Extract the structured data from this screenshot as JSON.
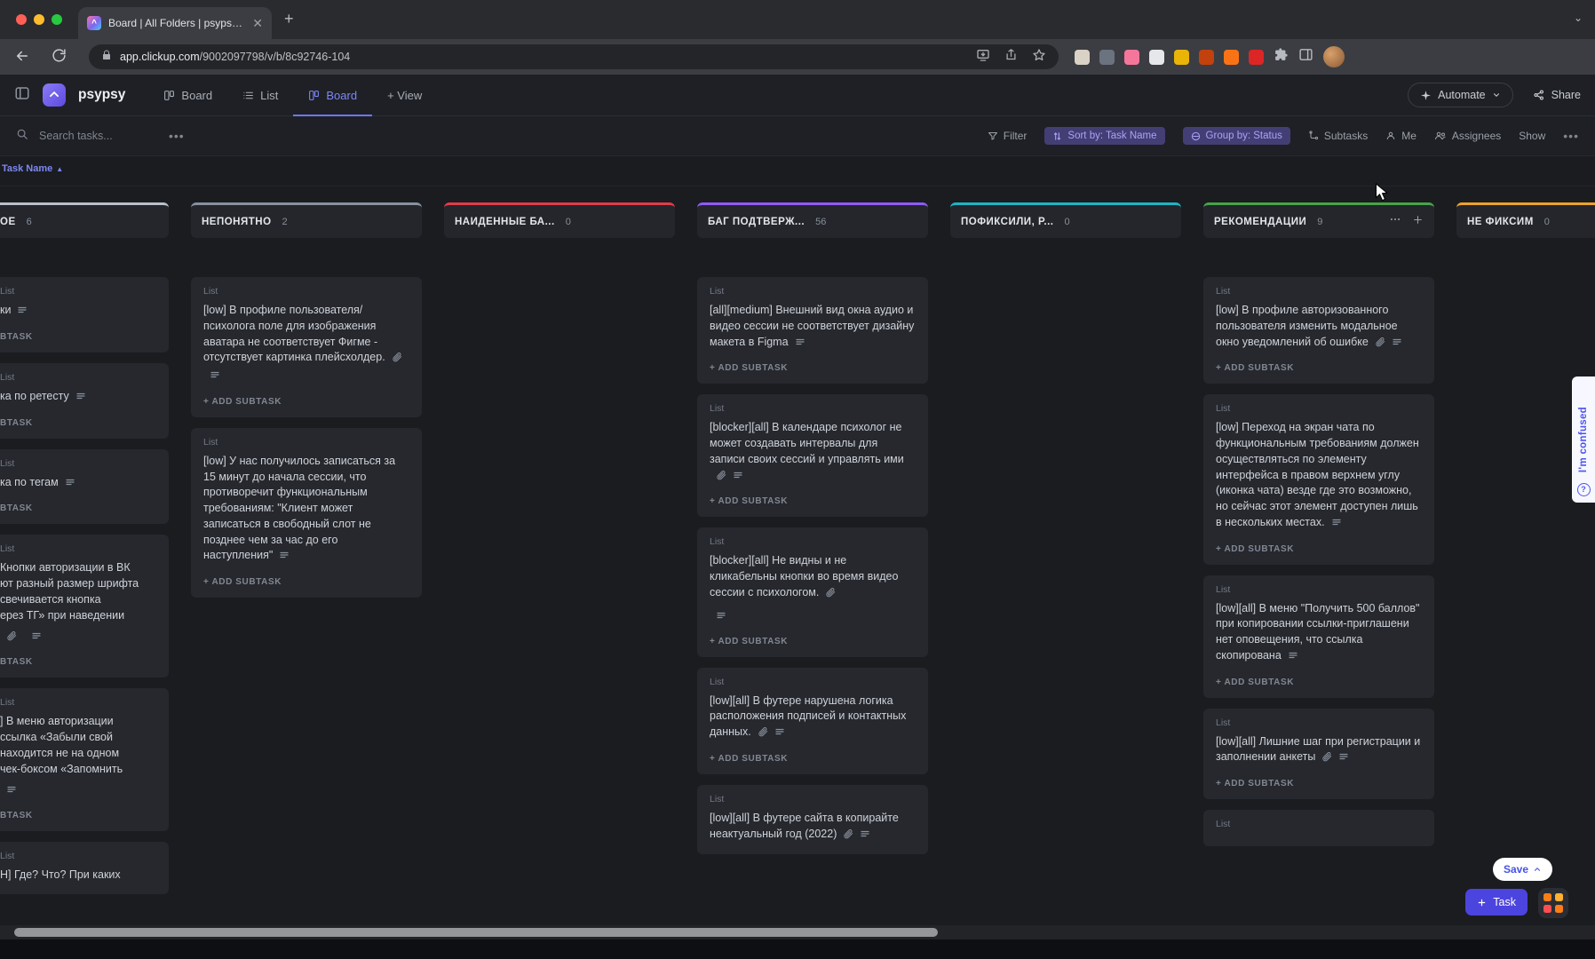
{
  "browser": {
    "tab_title": "Board | All Folders | psypsy.onl",
    "url_host": "app.clickup.com",
    "url_path": "/9002097798/v/b/8c92746-104",
    "extension_colors": [
      "#d9d2c5",
      "#6b7280",
      "#f5769b",
      "#e5e7eb",
      "#eab308",
      "#c2410c",
      "#f97316",
      "#dc2626"
    ]
  },
  "header": {
    "workspace": "psypsy",
    "nav": [
      {
        "label": "Board"
      },
      {
        "label": "List"
      },
      {
        "label": "Board"
      },
      {
        "label": "+ View"
      }
    ],
    "automate_label": "Automate",
    "share_label": "Share"
  },
  "filterbar": {
    "search_placeholder": "Search tasks...",
    "filter_label": "Filter",
    "sort_label": "Sort by: Task Name",
    "group_label": "Group by: Status",
    "subtasks_label": "Subtasks",
    "me_label": "Me",
    "assignees_label": "Assignees",
    "show_label": "Show"
  },
  "sort_chip": {
    "label": "Task Name"
  },
  "board": {
    "list_label": "List",
    "add_subtask_label": "+ ADD SUBTASK",
    "columns": [
      {
        "name": "ОЕ",
        "count": "6",
        "color": "#b9c0cb",
        "partial": true,
        "cards": [
          {
            "lines": [
              "ки"
            ],
            "icons": [
              "desc"
            ],
            "add_label": "BTASK"
          },
          {
            "lines": [
              "ка по ретесту"
            ],
            "icons": [
              "desc"
            ],
            "add_label": "BTASK"
          },
          {
            "lines": [
              "ка по тегам"
            ],
            "icons": [
              "desc"
            ],
            "add_label": "BTASK"
          },
          {
            "lines": [
              "Кнопки авторизации в ВК",
              "ют разный размер шрифта",
              "свечивается кнопка",
              "ерез ТГ» при наведении"
            ],
            "icons_below": [
              "paperclip",
              "desc"
            ],
            "add_label": "BTASK"
          },
          {
            "lines": [
              "] В меню авторизации",
              "ссылка «Забыли свой",
              "находится не на одном",
              "чек-боксом «Запомнить"
            ],
            "icons_below": [
              "desc"
            ],
            "add_label": "BTASK"
          },
          {
            "lines": [
              "Н] Где? Что? При каких"
            ]
          }
        ]
      },
      {
        "name": "НЕПОНЯТНО",
        "count": "2",
        "color": "#87909e",
        "cards": [
          {
            "text": "[low] В профиле пользователя/психолога поле для изображения аватара не соответствует Фигме - отсутствует картинка плейсхолдер.",
            "icons": [
              "paperclip",
              "desc"
            ],
            "add": true
          },
          {
            "text": "[low] У нас получилось записаться за 15 минут до начала сессии, что противоречит функциональным требованиям: \"Клиент может записаться в свободный слот не позднее чем за час до его наступления\"",
            "icons": [
              "desc"
            ],
            "add": true
          }
        ]
      },
      {
        "name": "НАЙДЕННЫЕ БА...",
        "count": "0",
        "color": "#e03c48",
        "cards": []
      },
      {
        "name": "БАГ ПОДТВЕРЖ...",
        "count": "56",
        "color": "#8e5bf5",
        "cards": [
          {
            "text": "[all][medium] Внешний вид окна аудио и видео сессии не соответствует дизайну макета в Figma",
            "icons": [
              "desc"
            ],
            "add": true
          },
          {
            "text": "[blocker][all] В календаре психолог не может создавать интервалы для записи своих сессий и управлять ими",
            "icons": [
              "paperclip",
              "desc"
            ],
            "add": true
          },
          {
            "text": "[blocker][all] Не видны и не кликабельны кнопки во время видео сессии с психологом.",
            "icons": [
              "paperclip"
            ],
            "icons_below": [
              "desc"
            ],
            "add": true
          },
          {
            "text": "[low][all] В футере нарушена логика расположения подписей и контактных данных.",
            "icons": [
              "paperclip",
              "desc"
            ],
            "add": true
          },
          {
            "text": "[low][all] В футере сайта в копирайте неактуальный год (2022)",
            "icons": [
              "paperclip",
              "desc"
            ]
          }
        ]
      },
      {
        "name": "ПОФИКСИЛИ, Р...",
        "count": "0",
        "color": "#1db5c4",
        "cards": []
      },
      {
        "name": "РЕКОМЕНДАЦИИ",
        "count": "9",
        "color": "#47a447",
        "actions": true,
        "cards": [
          {
            "text": "[low] В профиле авторизованного пользователя изменить модальное окно уведомлений об ошибке",
            "icons": [
              "paperclip",
              "desc"
            ],
            "add": true
          },
          {
            "text": "[low] Переход на экран чата по функциональным требованиям должен осуществляться по элементу интерфейса в правом верхнем углу (иконка чата) везде где это возможно, но сейчас этот элемент доступен лишь в нескольких местах.",
            "icons": [
              "desc"
            ],
            "add": true
          },
          {
            "text": "[low][all] В меню \"Получить 500 баллов\" при копировании ссылки-приглашени нет оповещения, что ссылка скопирована",
            "icons": [
              "desc"
            ],
            "add": true
          },
          {
            "text": "[low][all] Лишние шаг при регистрации и заполнении анкеты",
            "icons": [
              "paperclip",
              "desc"
            ],
            "add": true
          },
          {
            "label_only": true
          }
        ]
      },
      {
        "name": "НЕ ФИКСИМ",
        "count": "0",
        "color": "#eda22d",
        "cards": []
      }
    ]
  },
  "feedback": {
    "label": "I'm confused"
  },
  "footer": {
    "save_label": "Save",
    "task_label": "Task"
  }
}
